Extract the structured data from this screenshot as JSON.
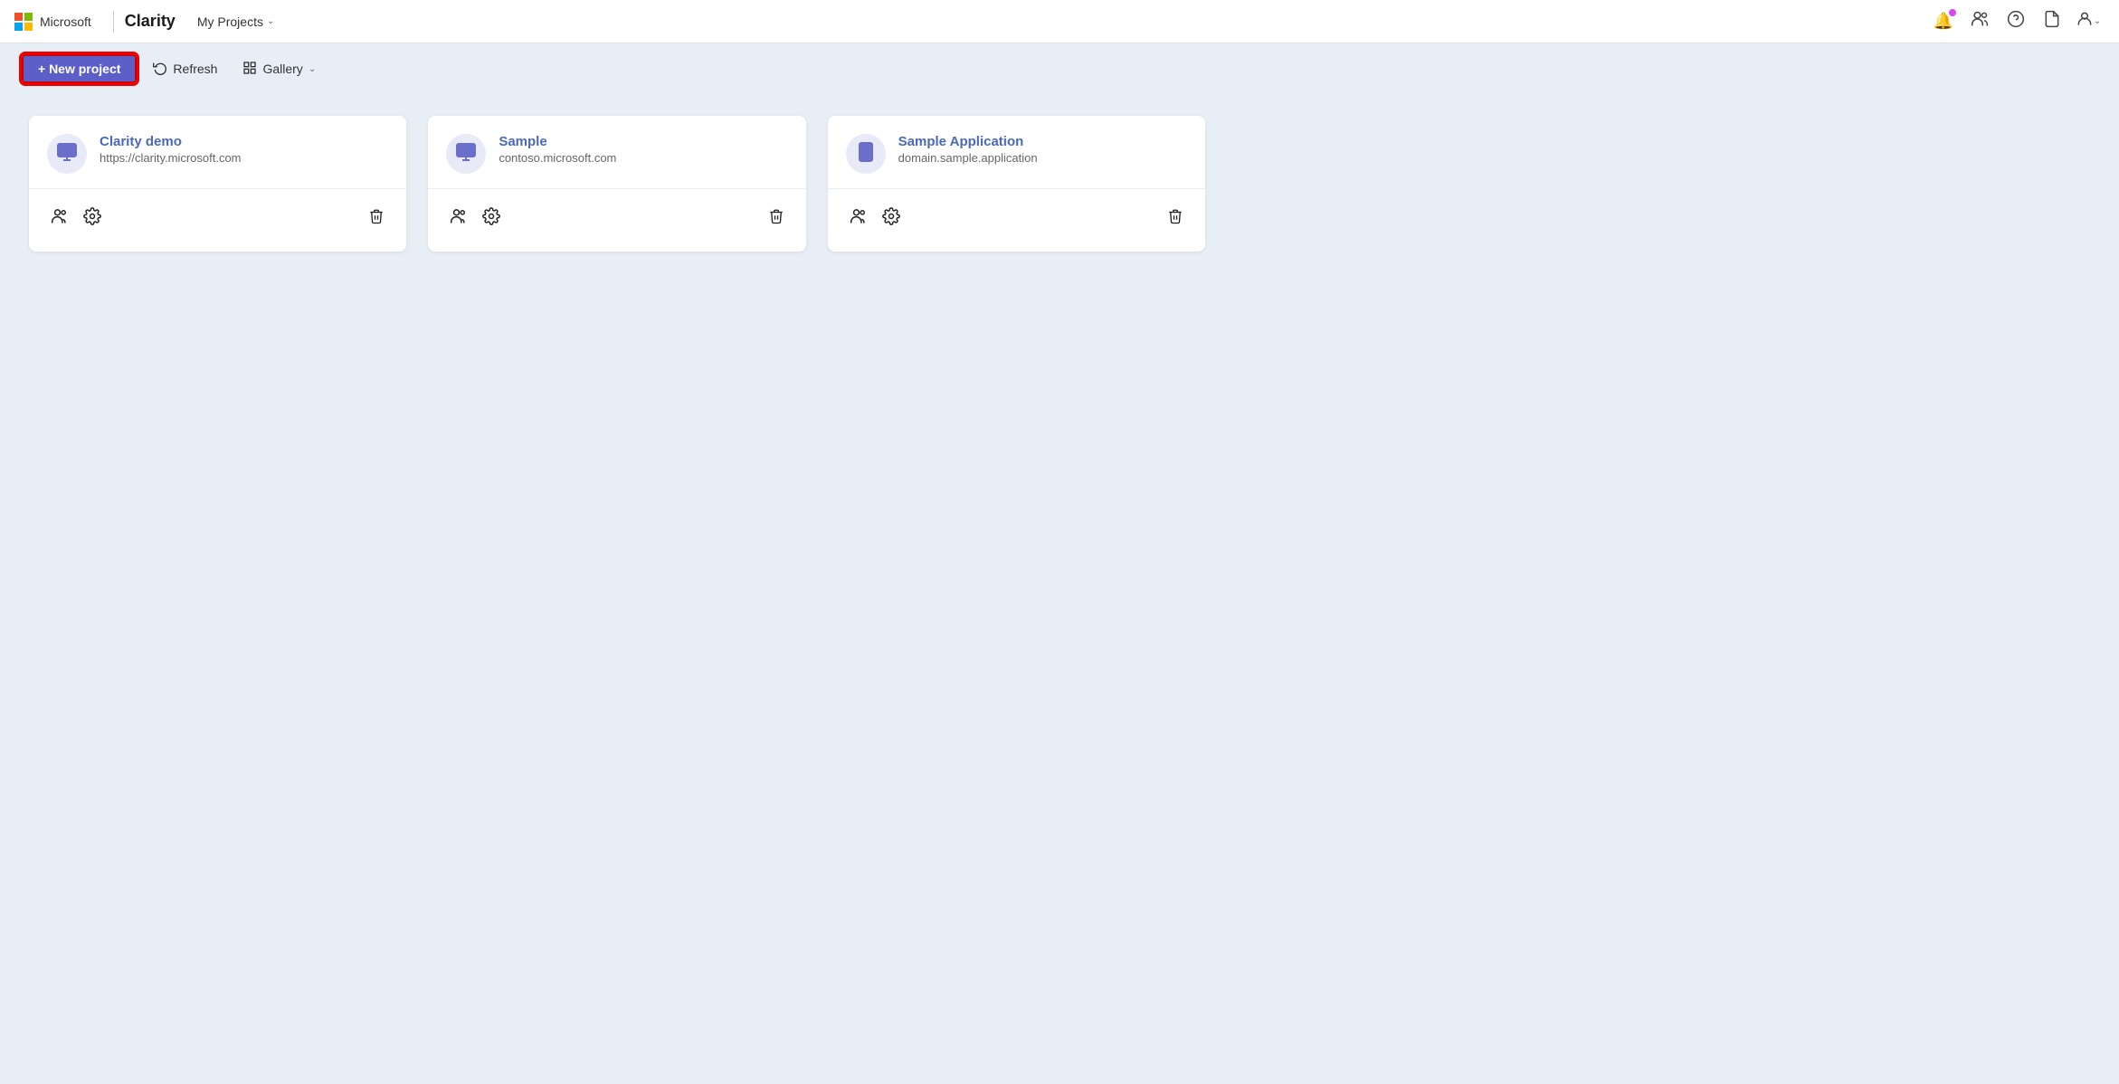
{
  "nav": {
    "microsoft_label": "Microsoft",
    "app_name": "Clarity",
    "menu_label": "My Projects",
    "menu_chevron": "∨",
    "icons": {
      "bell": "🔔",
      "people": "👥",
      "help": "❓",
      "document": "📄",
      "user": "👤"
    }
  },
  "toolbar": {
    "new_project_label": "+ New project",
    "refresh_label": "Refresh",
    "gallery_label": "Gallery"
  },
  "projects": [
    {
      "id": "clarity-demo",
      "title": "Clarity demo",
      "url": "https://clarity.microsoft.com",
      "icon_type": "monitor"
    },
    {
      "id": "sample",
      "title": "Sample",
      "url": "contoso.microsoft.com",
      "icon_type": "monitor"
    },
    {
      "id": "sample-application",
      "title": "Sample Application",
      "url": "domain.sample.application",
      "icon_type": "phone"
    }
  ]
}
